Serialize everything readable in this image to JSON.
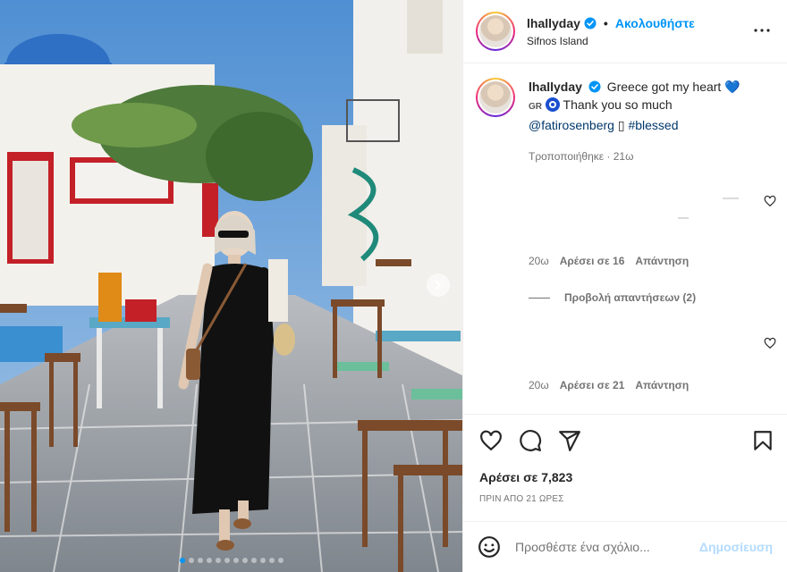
{
  "post": {
    "username": "lhallyday",
    "follow_label": "Ακολουθήστε",
    "separator": "•",
    "location": "Sifnos Island",
    "more_icon": "more-horizontal-icon",
    "verified_color": "#0095f6"
  },
  "caption": {
    "username": "lhallyday",
    "text_line1": "Greece got my heart",
    "heart": "💙",
    "flag_label": "GR",
    "text_line2": "Thank you so much",
    "mention": "@fatirosenberg",
    "missing_glyph": "▯",
    "hashtag": "#blessed",
    "meta": "Τροποποιήθηκε · 21ω"
  },
  "comments": [
    {
      "time": "20ω",
      "likes": "Αρέσει σε 16",
      "reply": "Απάντηση"
    },
    {
      "time": "20ω",
      "likes": "Αρέσει σε 21",
      "reply": "Απάντηση"
    }
  ],
  "view_replies": "Προβολή απαντήσεων (2)",
  "actions": {
    "likes": "Αρέσει σε 7,823",
    "timestamp": "ΠΡΙΝ ΑΠΟ 21 ΩΡΕΣ"
  },
  "add_comment": {
    "placeholder": "Προσθέστε ένα σχόλιο...",
    "post_label": "Δημοσίευση"
  },
  "carousel": {
    "total": 12,
    "active_index": 0
  },
  "colors": {
    "accent": "#0095f6",
    "link": "#00376b",
    "muted": "#737373"
  }
}
